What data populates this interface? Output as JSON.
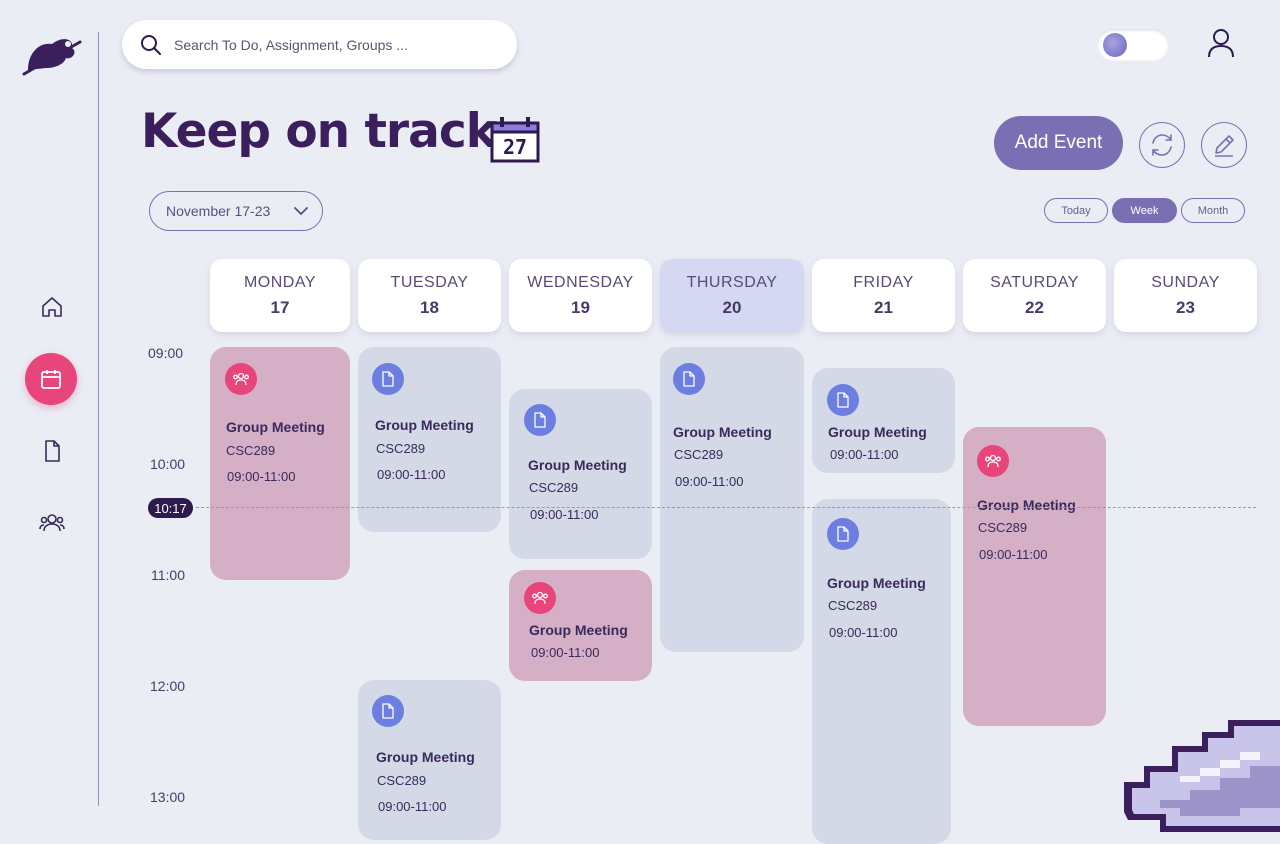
{
  "search": {
    "placeholder": "Search To Do, Assignment, Groups ..."
  },
  "page": {
    "title": "Keep on track",
    "calendar_emoji_text": "27"
  },
  "toolbar": {
    "add_event_label": "Add Event"
  },
  "range": {
    "label": "November 17-23"
  },
  "views": [
    {
      "label": "Today"
    },
    {
      "label": "Week",
      "active": true
    },
    {
      "label": "Month"
    }
  ],
  "days": [
    {
      "name": "MONDAY",
      "date": "17"
    },
    {
      "name": "TUESDAY",
      "date": "18"
    },
    {
      "name": "WEDNESDAY",
      "date": "19"
    },
    {
      "name": "THURSDAY",
      "date": "20",
      "today": true
    },
    {
      "name": "FRIDAY",
      "date": "21"
    },
    {
      "name": "SATURDAY",
      "date": "22"
    },
    {
      "name": "SUNDAY",
      "date": "23"
    }
  ],
  "times": [
    "09:00",
    "10:00",
    "11:00",
    "12:00",
    "13:00"
  ],
  "now": {
    "label": "10:17"
  },
  "events": [
    {
      "title": "Group Meeting",
      "code": "CSC289",
      "time": "09:00-11:00",
      "type": "group"
    },
    {
      "title": "Group Meeting",
      "code": "CSC289",
      "time": "09:00-11:00",
      "type": "doc"
    },
    {
      "title": "Group Meeting",
      "code": "CSC289",
      "time": "09:00-11:00",
      "type": "doc"
    },
    {
      "title": "Group Meeting",
      "code": "CSC289",
      "time": "09:00-11:00",
      "type": "doc"
    },
    {
      "title": "Group Meeting",
      "code": "CSC289",
      "time": "09:00-11:00",
      "type": "doc"
    },
    {
      "title": "Group Meeting",
      "code": "CSC289",
      "time": "09:00-11:00",
      "type": "doc"
    },
    {
      "title": "Group Meeting",
      "code": "CSC289",
      "time": "09:00-11:00",
      "type": "group"
    },
    {
      "title": "Group Meeting",
      "code": "CSC289",
      "time": "09:00-11:00",
      "type": "group"
    },
    {
      "title": "Group Meeting",
      "code": "",
      "time": "09:00-11:00",
      "type": "group"
    },
    {
      "title": "Group Meeting",
      "code": "",
      "time": "09:00-11:00",
      "type": "doc"
    }
  ],
  "colors": {
    "accent": "#7b6fb3",
    "pink": "#e8457a",
    "doc_bg": "#d3d9e6",
    "group_bg": "#d4afc6",
    "today_bg": "#d4d8f2",
    "dark": "#3a1f5c"
  },
  "icons": [
    "koala-logo-icon",
    "search-icon",
    "user-icon",
    "home-icon",
    "calendar-icon",
    "document-icon",
    "group-icon",
    "refresh-icon",
    "edit-icon",
    "chevron-down-icon"
  ]
}
